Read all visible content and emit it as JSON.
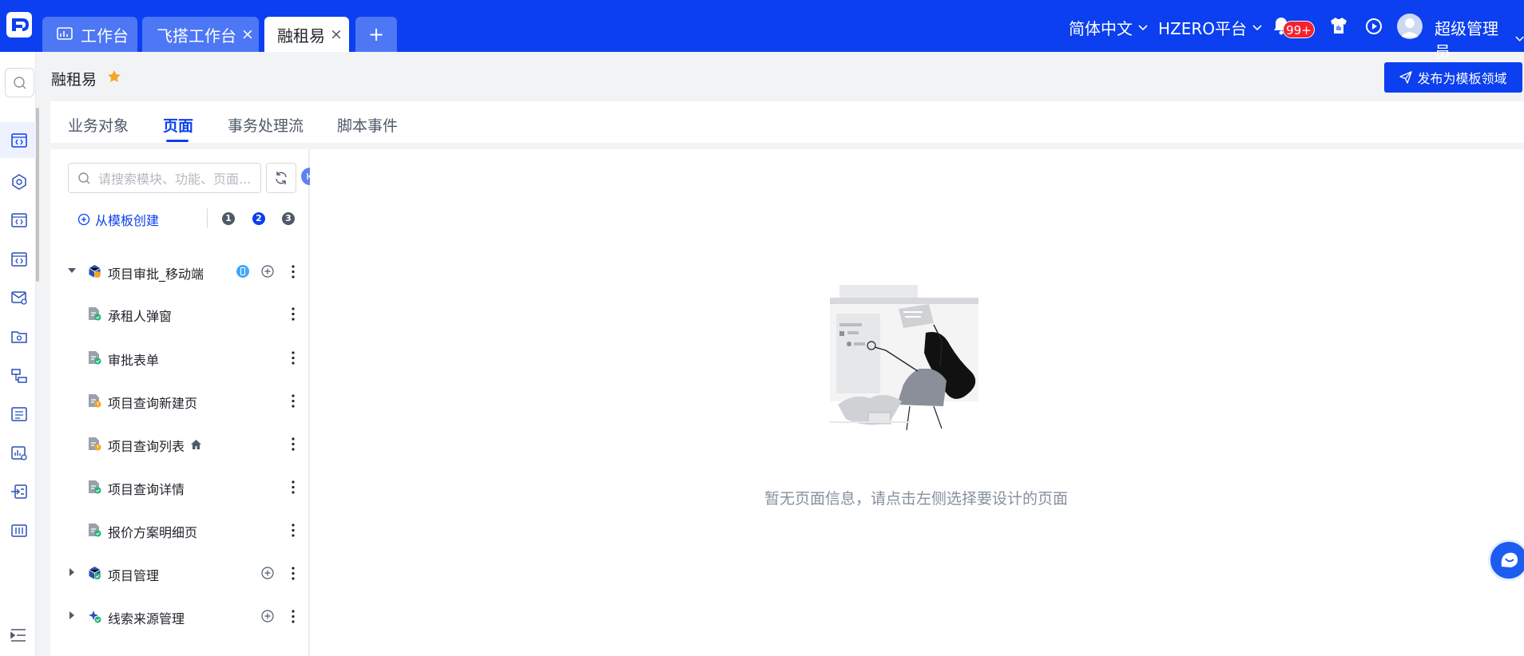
{
  "app": {
    "tabs": [
      {
        "label": "工作台",
        "icon": "dashboard-icon"
      },
      {
        "label": "飞搭工作台",
        "closable": true
      },
      {
        "label": "融租易",
        "closable": true,
        "active": true
      },
      {
        "label": "+"
      }
    ],
    "close_glyph": "×",
    "language": "简体中文",
    "platform": "HZERO平台",
    "notifications_badge": "99+",
    "user": "超级管理员",
    "brand_color": "#0b3fef"
  },
  "rail": {
    "icons": [
      "search-icon",
      "page-code-icon",
      "module-icon",
      "page-code-icon",
      "page-code-icon",
      "mail-settings-icon",
      "folder-settings-icon",
      "flow-icon",
      "list-settings-icon",
      "chart-settings-icon",
      "import-icon",
      "sliders-icon",
      "menu-toggle-icon"
    ]
  },
  "page": {
    "breadcrumb": "融租易",
    "publish_button": "发布为模板领域",
    "tabs": [
      "业务对象",
      "页面",
      "事务处理流",
      "脚本事件"
    ],
    "active_tab": "页面"
  },
  "tree": {
    "search_placeholder": "请搜索模块、功能、页面...",
    "create_from_template": "从模板创建",
    "steps": [
      "1",
      "2",
      "3"
    ],
    "current_step": "2",
    "nodes": [
      {
        "label": "项目审批_移动端",
        "level": 0,
        "expanded": true,
        "icon": "module-cube-icon"
      },
      {
        "label": "承租人弹窗",
        "level": 1,
        "icon": "page-check-icon"
      },
      {
        "label": "审批表单",
        "level": 1,
        "icon": "page-check-icon"
      },
      {
        "label": "项目查询新建页",
        "level": 1,
        "icon": "page-warning-icon"
      },
      {
        "label": "项目查询列表",
        "level": 1,
        "icon": "page-warning-icon",
        "home": true
      },
      {
        "label": "项目查询详情",
        "level": 1,
        "icon": "page-check-icon"
      },
      {
        "label": "报价方案明细页",
        "level": 1,
        "icon": "page-check-icon"
      },
      {
        "label": "项目管理",
        "level": 0,
        "expanded": false,
        "icon": "module-check-icon"
      },
      {
        "label": "线索来源管理",
        "level": 0,
        "expanded": false,
        "icon": "module-sparkle-icon"
      }
    ]
  },
  "content": {
    "empty_message": "暂无页面信息，请点击左侧选择要设计的页面"
  }
}
